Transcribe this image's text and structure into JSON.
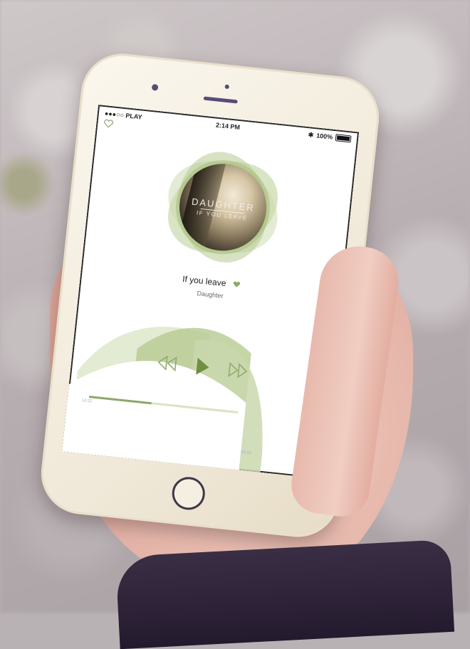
{
  "status_bar": {
    "carrier": "●●●○○ PLAY",
    "time": "2:14 PM",
    "battery": "100%"
  },
  "album": {
    "artist_on_cover": "DAUGHTER",
    "title_on_cover": "IF YOU LEAVE"
  },
  "track": {
    "title": "If you leave",
    "artist": "Daughter",
    "elapsed": "14:22",
    "total": "02:02",
    "progress": 0.42
  },
  "colors": {
    "accent": "#8ea86a",
    "accent_light": "#c9d8ad",
    "accent_pale": "#e3ebd3"
  },
  "icons": {
    "favorite": "heart-icon",
    "rewind": "rewind-icon",
    "play": "play-icon",
    "forward": "fast-forward-icon"
  }
}
